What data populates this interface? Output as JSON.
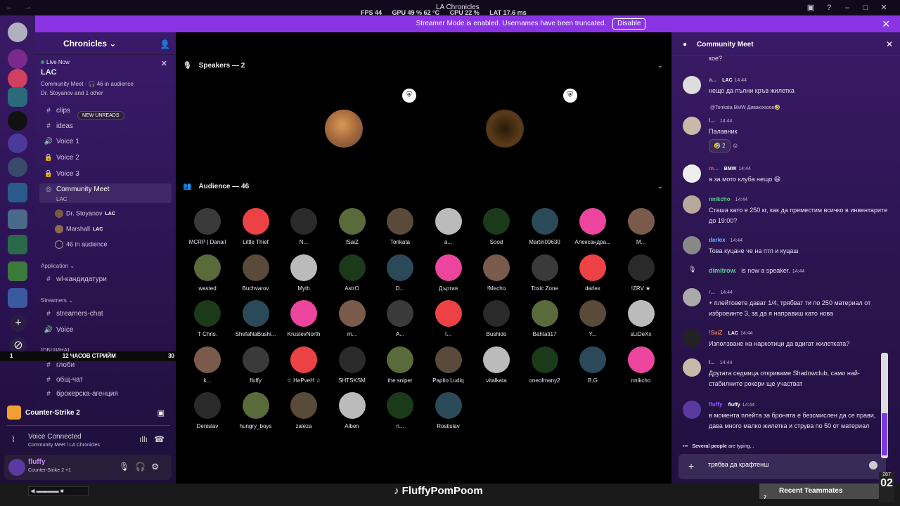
{
  "titlebar": {
    "app_title": "LA Chronicles",
    "stats": [
      "FPS 44",
      "GPU 49 % 62 °C",
      "CPU 22 %",
      "LAT 17.6 ms"
    ]
  },
  "banner": {
    "text": "Streamer Mode is enabled. Usernames have been truncated.",
    "button": "Disable"
  },
  "server": {
    "name": "Chronicles",
    "live_label": "Live Now",
    "live_channel": "LAC",
    "live_meta": "Community Meet · 🎧 46 in audience",
    "live_users": "Dr. Stoyanov and 1 other",
    "new_unreads": "NEW UNREADS"
  },
  "channels": {
    "items": [
      {
        "icon": "#",
        "label": "clips"
      },
      {
        "icon": "#",
        "label": "ideas"
      },
      {
        "icon": "🔊",
        "label": "Voice 1"
      },
      {
        "icon": "🔒",
        "label": "Voice 2"
      },
      {
        "icon": "🔒",
        "label": "Voice 3"
      }
    ],
    "stage": {
      "label": "Community Meet",
      "sub": "LAC"
    },
    "stage_users": [
      {
        "name": "Dr. Stoyanov",
        "tag": "LAC"
      },
      {
        "name": "Marshall",
        "tag": "LAC"
      },
      {
        "name": "46 in audience",
        "tag": ""
      }
    ],
    "cat_application": "Application",
    "application_channel": "wl-кандидатури",
    "cat_streamers": "Streamers",
    "streamers_chat": "streamers-chat",
    "streamers_voice": "Voice",
    "cat_hidden": "[ОБЩИНА]",
    "extra": [
      "глоби",
      "общ-чат",
      "брокерска-агенция"
    ]
  },
  "overlay_mid": {
    "left": "1",
    "text": "12 ЧАСОВ СТРИЙМ",
    "right": "30"
  },
  "game": {
    "name": "Counter-Strike 2"
  },
  "voice": {
    "status": "Voice Connected",
    "channel": "Community Meet / LA Chronicles"
  },
  "user": {
    "name": "fluffy",
    "status": "Counter-Strike 2 +1"
  },
  "stage_view": {
    "speakers_title": "Speakers — 2",
    "audience_title": "Audience — 46",
    "speaker_colors": [
      "#8b7c6f",
      "#7a4a12"
    ],
    "audience": [
      "MCRP | Danail",
      "Little Thief",
      "N...",
      "!SaiZ",
      "Tonkata",
      "a...",
      "Sood",
      "Martin09630",
      "Александра...",
      "M...",
      "wasted",
      "Buchvarov",
      "Myth",
      "AstrO",
      "D...",
      "Дъртия",
      "!Mecho",
      "Toxic Zone",
      "darlex",
      "!ZRV ★",
      "Ƭ Chris.",
      "ShefaNaBushi...",
      "KrustevNorth",
      "m...",
      "A...",
      "I...",
      "Bushido",
      "Bahtati17",
      "Y...",
      "sLiDeXx",
      "k...",
      "fluffy",
      "☆ НеРvеН ☆",
      "SHTSKSM",
      "the sniper",
      "Papito Ludiq",
      "vitalkata",
      "oneofmany2",
      "B.G",
      "nnikcho",
      "Denislav",
      "hungry_boys",
      "zaleza",
      "Alben",
      "n...",
      "Rostislav"
    ]
  },
  "chat": {
    "title": "Community Meet",
    "messages": [
      {
        "name": "",
        "tag": "",
        "time": "",
        "text": "кое?"
      },
      {
        "name": "a...",
        "tag": "LAC",
        "time": "14:44",
        "text": "нещо да пълни кръв жилетка"
      },
      {
        "name": "I...",
        "tag": "",
        "time": "14:44",
        "text": "Палавник"
      },
      {
        "name": "m...",
        "tag": "BMW",
        "time": "14:44",
        "text": "а за мото клуба нещо 😄"
      },
      {
        "name": "nnikcho",
        "tag": "",
        "time": "14:44",
        "text": "Сташа като е 250 кг, как да преместим всичко в инвентарите до 19:00?"
      },
      {
        "name": "darlex",
        "tag": "",
        "time": "14:44",
        "text": "Това куцане че на птп и куцаш"
      },
      {
        "name": "dimitrow.",
        "tag": "",
        "time": "14:44",
        "text": "is now a speaker."
      },
      {
        "name": "r...",
        "tag": "",
        "time": "14:44",
        "text": "+ плейтовете дават 1/4, трябват ти по 250 материал от изброеинте 3, за да я направиш като нова"
      },
      {
        "name": "!SaiZ",
        "tag": "LAC",
        "time": "14:44",
        "text": "Използване на наркотици да вдигат жилетката?"
      },
      {
        "name": "I...",
        "tag": "",
        "time": "14:44",
        "text": "Другата седмица откриваме Shadowclub, само най-стабилните рокери ще участват"
      },
      {
        "name": "fluffy",
        "tag": "fluffy",
        "time": "14:44",
        "text": "в момента плейта за бронята е безсмислен да се прави, дава много малко жилетка и струва по 50 от материал"
      }
    ],
    "reply_preview": "@Tonkata  BMW  Дивакооооо🤣",
    "reaction": "🤣 2",
    "typing_who": "Several people",
    "typing_suffix": "are typing...",
    "input_value": "трябва да крафтенш"
  },
  "taskbar": {
    "tiktok": "FluffyPomPoom",
    "recent": "Recent Teammates",
    "recent_count": "7",
    "counter_top": "287",
    "counter_big": "02"
  }
}
